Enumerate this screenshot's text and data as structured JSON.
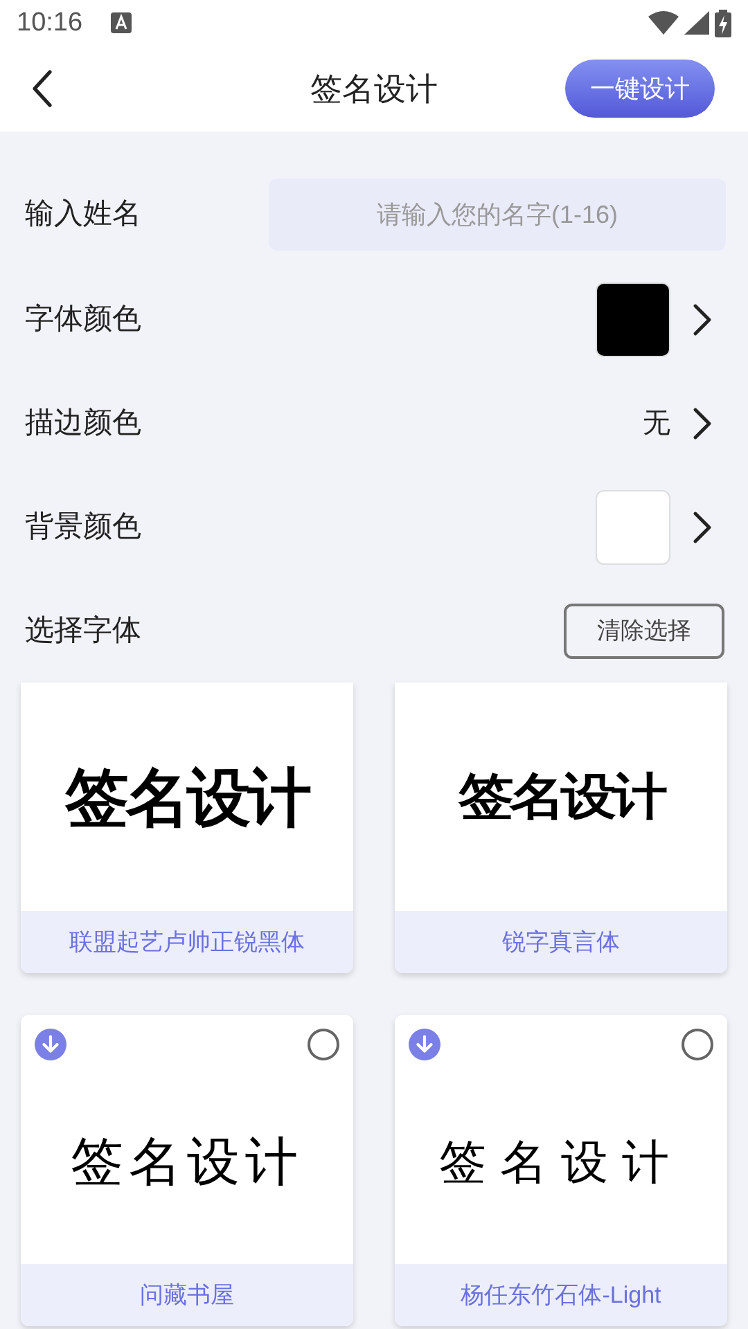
{
  "status_bar": {
    "time": "10:16"
  },
  "header": {
    "title": "签名设计",
    "action": "一键设计"
  },
  "form": {
    "name": {
      "label": "输入姓名",
      "placeholder": "请输入您的名字(1-16)"
    },
    "font_color": {
      "label": "字体颜色",
      "color": "#000000"
    },
    "outline_color": {
      "label": "描边颜色",
      "value": "无"
    },
    "background_color": {
      "label": "背景颜色",
      "color": "#ffffff"
    },
    "choose_font": {
      "label": "选择字体",
      "clear": "清除选择"
    }
  },
  "fonts": [
    {
      "name": "联盟起艺卢帅正锐黑体",
      "preview": "签名设计",
      "kind": "heavy"
    },
    {
      "name": "锐字真言体",
      "preview": "签名设计",
      "kind": "black"
    },
    {
      "name": "问藏书屋",
      "preview": "签名设计",
      "kind": "regular",
      "selected": false
    },
    {
      "name": "杨任东竹石体-Light",
      "preview": "签名设计",
      "kind": "light",
      "selected": false
    }
  ]
}
